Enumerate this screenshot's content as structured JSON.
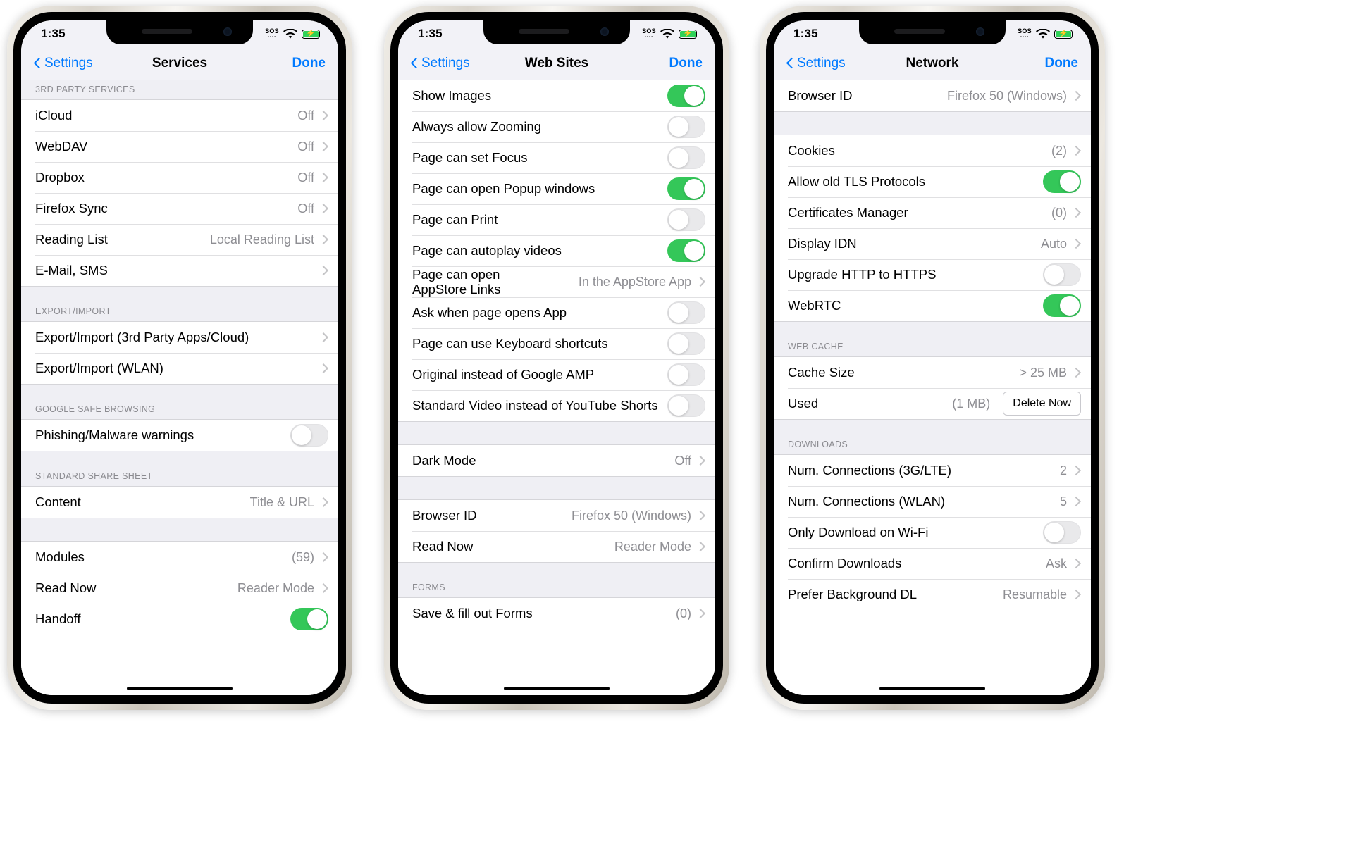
{
  "status": {
    "time": "1:35",
    "sos_label": "SOS",
    "sos_dots": "••••",
    "wifi_icon": "wifi-icon",
    "battery_icon": "battery-charging-icon"
  },
  "phones": [
    {
      "id": "services",
      "nav": {
        "back_label": "Settings",
        "title": "Services",
        "done_label": "Done"
      },
      "sections": [
        {
          "header": "3RD PARTY SERVICES",
          "rows": [
            {
              "label": "iCloud",
              "value": "Off",
              "type": "disclosure"
            },
            {
              "label": "WebDAV",
              "value": "Off",
              "type": "disclosure"
            },
            {
              "label": "Dropbox",
              "value": "Off",
              "type": "disclosure"
            },
            {
              "label": "Firefox Sync",
              "value": "Off",
              "type": "disclosure"
            },
            {
              "label": "Reading List",
              "value": "Local Reading List",
              "type": "disclosure"
            },
            {
              "label": "E-Mail, SMS",
              "value": "",
              "type": "disclosure"
            }
          ]
        },
        {
          "header": "EXPORT/IMPORT",
          "rows": [
            {
              "label": "Export/Import (3rd Party Apps/Cloud)",
              "value": "",
              "type": "disclosure"
            },
            {
              "label": "Export/Import (WLAN)",
              "value": "",
              "type": "disclosure"
            }
          ]
        },
        {
          "header": "GOOGLE SAFE BROWSING",
          "rows": [
            {
              "label": "Phishing/Malware warnings",
              "value": "",
              "type": "toggle",
              "on": false
            }
          ]
        },
        {
          "header": "STANDARD SHARE SHEET",
          "rows": [
            {
              "label": "Content",
              "value": "Title & URL",
              "type": "disclosure"
            }
          ]
        },
        {
          "header": "",
          "rows": [
            {
              "label": "Modules",
              "value": "(59)",
              "type": "disclosure"
            },
            {
              "label": "Read Now",
              "value": "Reader Mode",
              "type": "disclosure"
            },
            {
              "label": "Handoff",
              "value": "",
              "type": "toggle",
              "on": true
            }
          ]
        }
      ]
    },
    {
      "id": "websites",
      "nav": {
        "back_label": "Settings",
        "title": "Web Sites",
        "done_label": "Done"
      },
      "sections": [
        {
          "header": "",
          "rows": [
            {
              "label": "Show Images",
              "value": "",
              "type": "toggle",
              "on": true
            },
            {
              "label": "Always allow Zooming",
              "value": "",
              "type": "toggle",
              "on": false
            },
            {
              "label": "Page can set Focus",
              "value": "",
              "type": "toggle",
              "on": false
            },
            {
              "label": "Page can open Popup windows",
              "value": "",
              "type": "toggle",
              "on": true
            },
            {
              "label": "Page can Print",
              "value": "",
              "type": "toggle",
              "on": false
            },
            {
              "label": "Page can autoplay videos",
              "value": "",
              "type": "toggle",
              "on": true
            },
            {
              "label": "Page can open\nAppStore Links",
              "value": "In the AppStore App",
              "type": "disclosure"
            },
            {
              "label": "Ask when page opens App",
              "value": "",
              "type": "toggle",
              "on": false
            },
            {
              "label": "Page can use Keyboard shortcuts",
              "value": "",
              "type": "toggle",
              "on": false
            },
            {
              "label": "Original instead of Google AMP",
              "value": "",
              "type": "toggle",
              "on": false
            },
            {
              "label": "Standard Video instead of YouTube Shorts",
              "value": "",
              "type": "toggle",
              "on": false
            }
          ]
        },
        {
          "header": "",
          "rows": [
            {
              "label": "Dark Mode",
              "value": "Off",
              "type": "disclosure"
            }
          ]
        },
        {
          "header": "",
          "rows": [
            {
              "label": "Browser ID",
              "value": "Firefox 50 (Windows)",
              "type": "disclosure"
            },
            {
              "label": "Read Now",
              "value": "Reader Mode",
              "type": "disclosure"
            }
          ]
        },
        {
          "header": "FORMS",
          "rows": [
            {
              "label": "Save & fill out Forms",
              "value": "(0)",
              "type": "disclosure"
            }
          ]
        }
      ]
    },
    {
      "id": "network",
      "nav": {
        "back_label": "Settings",
        "title": "Network",
        "done_label": "Done"
      },
      "sections": [
        {
          "header": "",
          "rows": [
            {
              "label": "Browser ID",
              "value": "Firefox 50 (Windows)",
              "type": "disclosure"
            }
          ]
        },
        {
          "header": "",
          "rows": [
            {
              "label": "Cookies",
              "value": "(2)",
              "type": "disclosure"
            },
            {
              "label": "Allow old TLS Protocols",
              "value": "",
              "type": "toggle",
              "on": true
            },
            {
              "label": "Certificates Manager",
              "value": "(0)",
              "type": "disclosure"
            },
            {
              "label": "Display IDN",
              "value": "Auto",
              "type": "disclosure"
            },
            {
              "label": "Upgrade HTTP to HTTPS",
              "value": "",
              "type": "toggle",
              "on": false
            },
            {
              "label": "WebRTC",
              "value": "",
              "type": "toggle",
              "on": true
            }
          ]
        },
        {
          "header": "WEB CACHE",
          "rows": [
            {
              "label": "Cache Size",
              "value": "> 25 MB",
              "type": "disclosure"
            },
            {
              "label": "Used",
              "value": "(1 MB)",
              "type": "button",
              "button_label": "Delete Now"
            }
          ]
        },
        {
          "header": "DOWNLOADS",
          "rows": [
            {
              "label": "Num. Connections (3G/LTE)",
              "value": "2",
              "type": "disclosure"
            },
            {
              "label": "Num. Connections (WLAN)",
              "value": "5",
              "type": "disclosure"
            },
            {
              "label": "Only Download on Wi-Fi",
              "value": "",
              "type": "toggle",
              "on": false
            },
            {
              "label": "Confirm Downloads",
              "value": "Ask",
              "type": "disclosure"
            },
            {
              "label": "Prefer Background DL",
              "value": "Resumable",
              "type": "disclosure"
            }
          ]
        }
      ]
    }
  ],
  "colors": {
    "accent": "#007aff",
    "toggle_on": "#34c759",
    "toggle_off": "#e9e9eb",
    "value_text": "#8e8e93",
    "section_bg": "#efeff4"
  }
}
